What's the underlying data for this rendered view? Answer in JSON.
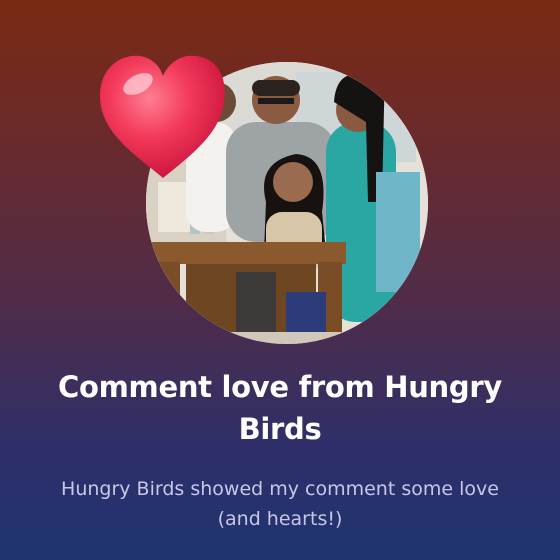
{
  "notification": {
    "title": "Comment love from Hungry Birds",
    "message": "Hungry Birds showed my comment some love (and hearts!)"
  },
  "icons": {
    "sticker": "heart-icon",
    "avatar": "group-photo"
  },
  "colors": {
    "gradient_top": "#7a2a12",
    "gradient_bottom": "#1f3470",
    "heart": "#e8274b",
    "title_text": "#ffffff",
    "message_text": "#c9c7e6"
  }
}
